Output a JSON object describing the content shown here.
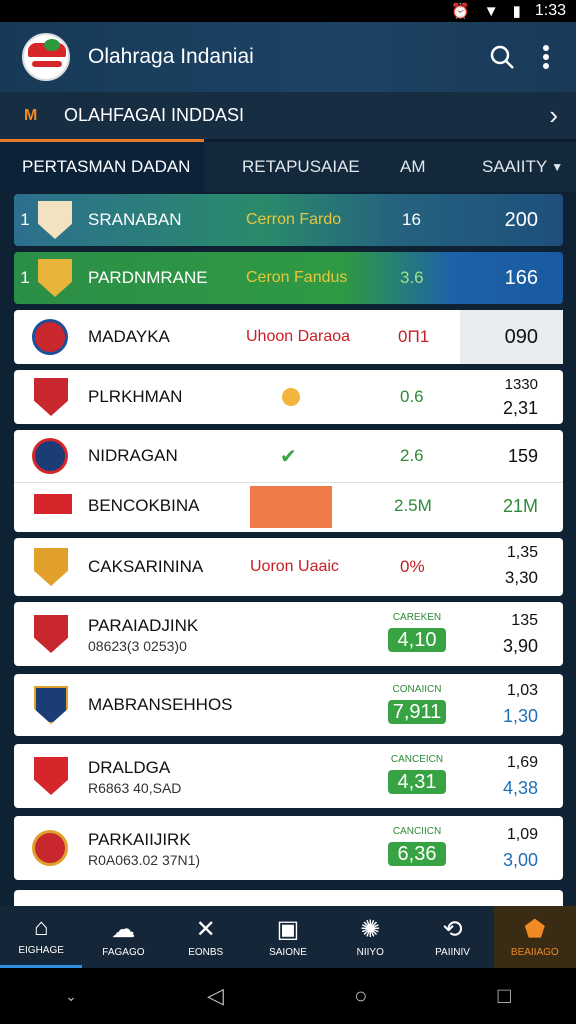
{
  "status": {
    "time": "1:33"
  },
  "app": {
    "title": "Olahraga Indaniai"
  },
  "section": {
    "title": "OLAHFAGAI INDDASI",
    "badge": "M"
  },
  "tabs": [
    "PERTASMAN DADAN",
    "RETAPUSAIAE",
    "AM",
    "SAAIITY"
  ],
  "rows": [
    {
      "rank": "1",
      "name": "SRANABAN",
      "mid": "Cerron Fardo",
      "c3": "16",
      "c4": "200"
    },
    {
      "rank": "1",
      "name": "PARDNMRANE",
      "mid": "Ceron Fandus",
      "c3": "3.6",
      "c4": "166"
    },
    {
      "name": "MADAYKA",
      "mid": "Uhoon Daraoa",
      "c3": "0Π1",
      "c4": "090"
    },
    {
      "name": "PLRKHMAN",
      "c3": "0.6",
      "c4a": "1330",
      "c4b": "2,31"
    },
    {
      "name": "NIDRAGAN",
      "c3": "2.6",
      "c4": "159"
    },
    {
      "name": "BENCOKBINA",
      "c3": "2.5M",
      "c4": "21M"
    },
    {
      "name": "CAKSARININA",
      "mid": "Uoron Uaaic",
      "c3": "0%",
      "c4a": "1,35",
      "c4b": "3,30"
    },
    {
      "name": "PARAIADJINK",
      "sub": "08623(3 0253)0",
      "plabel": "CAREKEN",
      "pill": "4,10",
      "c4a": "135",
      "c4b": "3,90"
    },
    {
      "name": "MABRANSEHHOS",
      "plabel": "CONAIICN",
      "pill": "7,911",
      "c4a": "1,03",
      "c4b": "1,30"
    },
    {
      "name": "DRALDGA",
      "sub": "R6863 40,SAD",
      "plabel": "CANCEICN",
      "pill": "4,31",
      "c4a": "1,69",
      "c4b": "4,38"
    },
    {
      "name": "PARKAIIJIRK",
      "sub": "R0A063.02 37N1)",
      "plabel": "CANCIICN",
      "pill": "6,36",
      "c4a": "1,09",
      "c4b": "3,00"
    }
  ],
  "nav": [
    "EIGHAGE",
    "FAGAGO",
    "EONBS",
    "SAIONE",
    "NIIYO",
    "PAIINIV",
    "BEAIIAGO"
  ],
  "colors": {
    "accent": "#f08a24",
    "green": "#37a342",
    "red": "#c81e25",
    "blue": "#1f6fb8"
  }
}
